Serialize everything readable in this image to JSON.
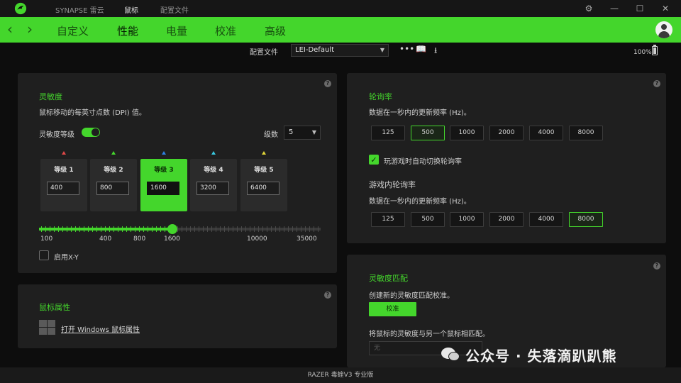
{
  "titlebar": {
    "app_name": "SYNAPSE 雷云",
    "tabs": [
      {
        "label": "鼠标",
        "active": true
      },
      {
        "label": "配置文件",
        "active": false
      }
    ],
    "window_controls": [
      "gear-icon",
      "minimize-icon",
      "maximize-icon",
      "close-icon"
    ]
  },
  "navbar": {
    "tabs": [
      {
        "label": "自定义",
        "active": false
      },
      {
        "label": "性能",
        "active": true
      },
      {
        "label": "电量",
        "active": false
      },
      {
        "label": "校准",
        "active": false
      },
      {
        "label": "高级",
        "active": false
      }
    ],
    "accent": "#44d62c"
  },
  "profile": {
    "label": "配置文件",
    "value": "LEI-Default",
    "battery": "100%"
  },
  "sensitivity": {
    "title": "灵敏度",
    "desc": "鼠标移动的每英寸点数 (DPI) 值。",
    "stage_toggle_label": "灵敏度等级",
    "stage_toggle_on": true,
    "level_count_label": "级数",
    "level_count": "5",
    "levels": [
      {
        "label": "等级 1",
        "value": "400",
        "color": "#e04848"
      },
      {
        "label": "等级 2",
        "value": "800",
        "color": "#44d62c"
      },
      {
        "label": "等级 3",
        "value": "1600",
        "color": "#2f7fe0",
        "active": true
      },
      {
        "label": "等级 4",
        "value": "3200",
        "color": "#38c9e0"
      },
      {
        "label": "等级 5",
        "value": "6400",
        "color": "#e0d438"
      }
    ],
    "slider_labels": [
      "100",
      "400",
      "800",
      "1600",
      "10000",
      "35000"
    ],
    "slider_value": 1600,
    "xy_label": "启用X-Y",
    "xy_enabled": false
  },
  "mouse_props": {
    "title": "鼠标属性",
    "link": "打开 Windows 鼠标属性"
  },
  "polling": {
    "title": "轮询率",
    "desc": "数据在一秒内的更新频率 (Hz)。",
    "rates": [
      "125",
      "500",
      "1000",
      "2000",
      "4000",
      "8000"
    ],
    "selected": "500",
    "auto_switch_label": "玩游戏时自动切换轮询率",
    "auto_switch": true,
    "ingame_title": "游戏内轮询率",
    "ingame_desc": "数据在一秒内的更新频率 (Hz)。",
    "ingame_selected": "8000"
  },
  "sensitivity_match": {
    "title": "灵敏度匹配",
    "desc": "创建新的灵敏度匹配校准。",
    "button": "校准",
    "match_desc": "将鼠标的灵敏度与另一个鼠标相匹配。",
    "select_placeholder": "无"
  },
  "footer": {
    "device": "RAZER 毒蝰V3 专业版"
  },
  "watermark": {
    "text": "公众号 · 失落滴趴趴熊"
  }
}
